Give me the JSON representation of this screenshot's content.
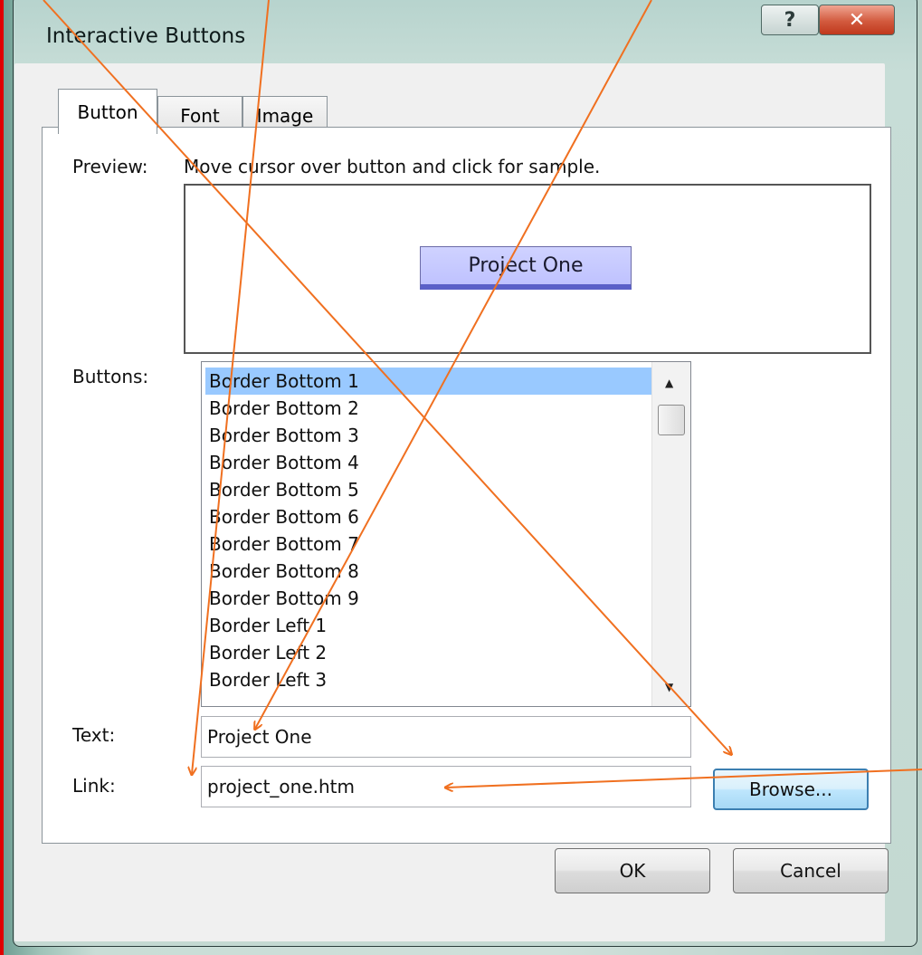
{
  "dialog": {
    "title": "Interactive Buttons",
    "help_glyph": "?",
    "close_glyph": "✕"
  },
  "tabs": [
    {
      "label": "Button",
      "active": true
    },
    {
      "label": "Font",
      "active": false
    },
    {
      "label": "Image",
      "active": false
    }
  ],
  "preview": {
    "label": "Preview:",
    "hint": "Move cursor over button and click for sample.",
    "sample_text": "Project One"
  },
  "buttons_list": {
    "label": "Buttons:",
    "items": [
      "Border Bottom 1",
      "Border Bottom 2",
      "Border Bottom 3",
      "Border Bottom 4",
      "Border Bottom 5",
      "Border Bottom 6",
      "Border Bottom 7",
      "Border Bottom 8",
      "Border Bottom 9",
      "Border Left 1",
      "Border Left 2",
      "Border Left 3"
    ],
    "selected": "Border Bottom 1"
  },
  "text_field": {
    "label": "Text:",
    "value": "Project One"
  },
  "link_field": {
    "label": "Link:",
    "value": "project_one.htm"
  },
  "actions": {
    "browse": "Browse...",
    "ok": "OK",
    "cancel": "Cancel"
  },
  "colors": {
    "selection": "#99c9ff",
    "annotation_arrows": "#f07020",
    "frame_border": "#e00000",
    "sample_button_fill": "#c4c6ff"
  }
}
